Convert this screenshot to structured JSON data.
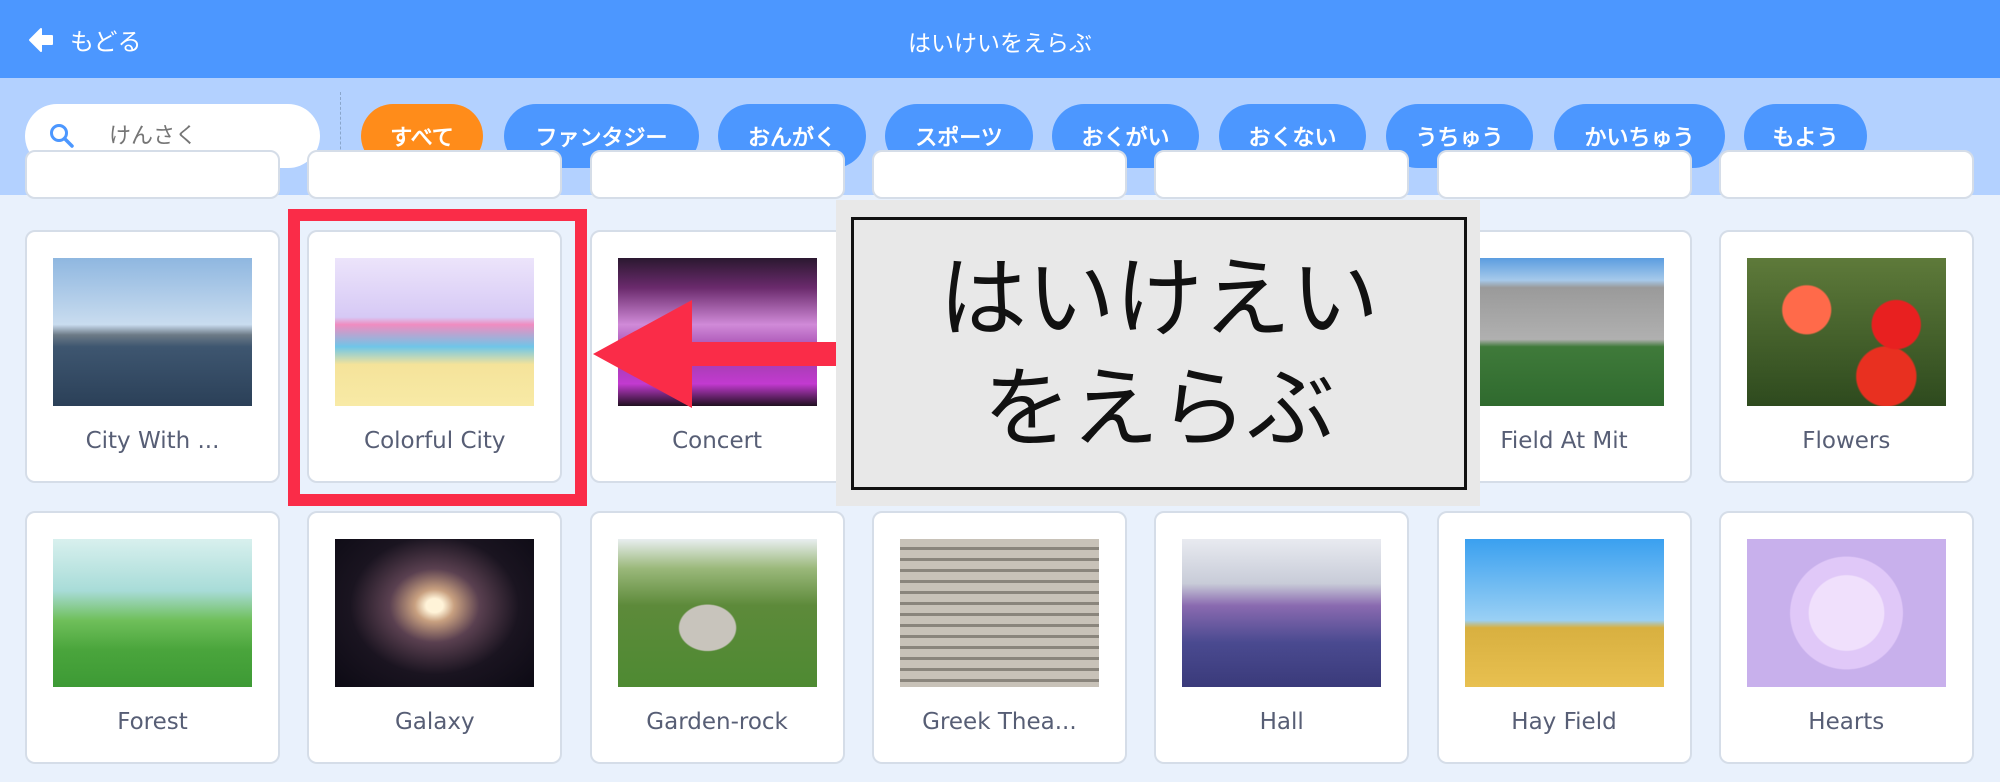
{
  "header": {
    "back_label": "もどる",
    "title": "はいけいをえらぶ"
  },
  "search": {
    "placeholder": "けんさく"
  },
  "filters": [
    {
      "label": "すべて",
      "active": true
    },
    {
      "label": "ファンタジー"
    },
    {
      "label": "おんがく"
    },
    {
      "label": "スポーツ"
    },
    {
      "label": "おくがい"
    },
    {
      "label": "おくない"
    },
    {
      "label": "うちゅう"
    },
    {
      "label": "かいちゅう"
    },
    {
      "label": "もよう"
    }
  ],
  "rows": [
    [
      "City With ...",
      "Colorful City",
      "Concert",
      "",
      "",
      "Field At Mit",
      "Flowers"
    ],
    [
      "Forest",
      "Galaxy",
      "Garden-rock",
      "Greek Thea...",
      "Hall",
      "Hay Field",
      "Hearts"
    ]
  ],
  "annotation": {
    "text": "はいけえいをえらぶ",
    "highlight_color": "#fa2c48"
  },
  "colors": {
    "header": "#4c97ff",
    "filterbar": "#b3d1ff",
    "active_filter": "#ff8c1a"
  }
}
